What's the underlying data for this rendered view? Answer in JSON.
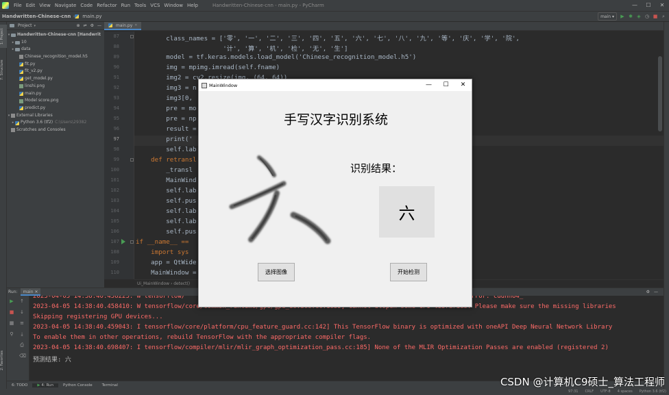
{
  "menubar": {
    "items": [
      "File",
      "Edit",
      "View",
      "Navigate",
      "Code",
      "Refactor",
      "Run",
      "Tools",
      "VCS",
      "Window",
      "Help"
    ],
    "window_title": "Handwritten-Chinese-cnn - main.py - PyCharm"
  },
  "navbar": {
    "project": "Handwritten-Chinese-cnn",
    "file": "main.py",
    "run_config": "main"
  },
  "left_strip": {
    "project_tab": "1: Project",
    "structure_tab": "7: Structure",
    "favorites_tab": "2: Favorites"
  },
  "project_panel": {
    "header": "Project",
    "root": "Handwritten-Chinese-cnn [Handwrit",
    "items": [
      {
        "label": "10",
        "type": "folder"
      },
      {
        "label": "data",
        "type": "folder"
      },
      {
        "label": "Chinese_recognition_model.h5",
        "type": "h5"
      },
      {
        "label": "fit.py",
        "type": "py"
      },
      {
        "label": "fit_v2.py",
        "type": "py"
      },
      {
        "label": "get_model.py",
        "type": "py"
      },
      {
        "label": "linshi.png",
        "type": "png"
      },
      {
        "label": "main.py",
        "type": "py"
      },
      {
        "label": "Model score.png",
        "type": "png"
      },
      {
        "label": "predict.py",
        "type": "py"
      }
    ],
    "external": "External Libraries",
    "python": "Python 3.6 (tf2)",
    "python_path": "C:\\Users\\29382",
    "scratches": "Scratches and Consoles"
  },
  "editor": {
    "tab": "main.py",
    "line_numbers": [
      "87",
      "88",
      "89",
      "90",
      "91",
      "92",
      "93",
      "94",
      "95",
      "96",
      "97",
      "98",
      "99",
      "100",
      "101",
      "102",
      "103",
      "104",
      "105",
      "106",
      "107",
      "108",
      "109",
      "110"
    ],
    "lines": [
      "        class_names = ['零', '一', '二', '三', '四', '五', '六', '七', '八', '九', '等', '庆', '学', '院',",
      "                       '计', '算', '机', '检', '无', '生']",
      "        model = tf.keras.models.load_model('Chinese_recognition_model.h5')",
      "        img = mpimg.imread(self.fname)",
      "        img2 = cv2.resize(img, (64, 64))",
      "        img3 = n",
      "        img3[0,",
      "        pre = mo",
      "        pre = np",
      "        result =",
      "        print('",
      "        self.lab",
      "    def retransl",
      "        _transl",
      "        MainWind",
      "        self.lab",
      "        self.pus",
      "        self.lab",
      "        self.lab",
      "        self.pus",
      "if __name__ ==",
      "    import sys",
      "    app = QtWide",
      "    MainWindow ="
    ],
    "breadcrumb": "Ui_MainWindow  ›  detect()"
  },
  "run_panel": {
    "label": "Run:",
    "tab": "main",
    "lines": [
      "2023-04-05 14:38:40.458223: W tensorflow/                                           namic library 'cudnn64_8.dll'; dlerror: cudnn64_",
      "2023-04-05 14:38:40.458410: W tensorflow/core/common_runtime/gpu/gpu_device.cc:1835] Cannot dlopen some GPU libraries. Please make sure the missing libraries",
      "Skipping registering GPU devices...",
      "2023-04-05 14:38:40.459043: I tensorflow/core/platform/cpu_feature_guard.cc:142] This TensorFlow binary is optimized with oneAPI Deep Neural Network Library",
      "To enable them in other operations, rebuild TensorFlow with the appropriate compiler flags.",
      "2023-04-05 14:38:40.698407: I tensorflow/compiler/mlir/mlir_graph_optimization_pass.cc:185] None of the MLIR Optimization Passes are enabled (registered 2)",
      "预测结果: 六"
    ]
  },
  "bottom_tools": [
    "6: TODO",
    "4: Run",
    "Python Console",
    "Terminal"
  ],
  "statusbar": {
    "position": "97:31",
    "line_sep": "CRLF",
    "encoding": "UTF-8",
    "indent": "4 spaces",
    "interpreter": "Python 3.6 (tf2)"
  },
  "watermark": "CSDN @计算机C9硕士_算法工程师",
  "dialog": {
    "window_title": "MainWindow",
    "heading": "手写汉字识别系统",
    "result_label": "识别结果：",
    "result_value": "六",
    "select_button": "选择图像",
    "detect_button": "开始检测"
  }
}
